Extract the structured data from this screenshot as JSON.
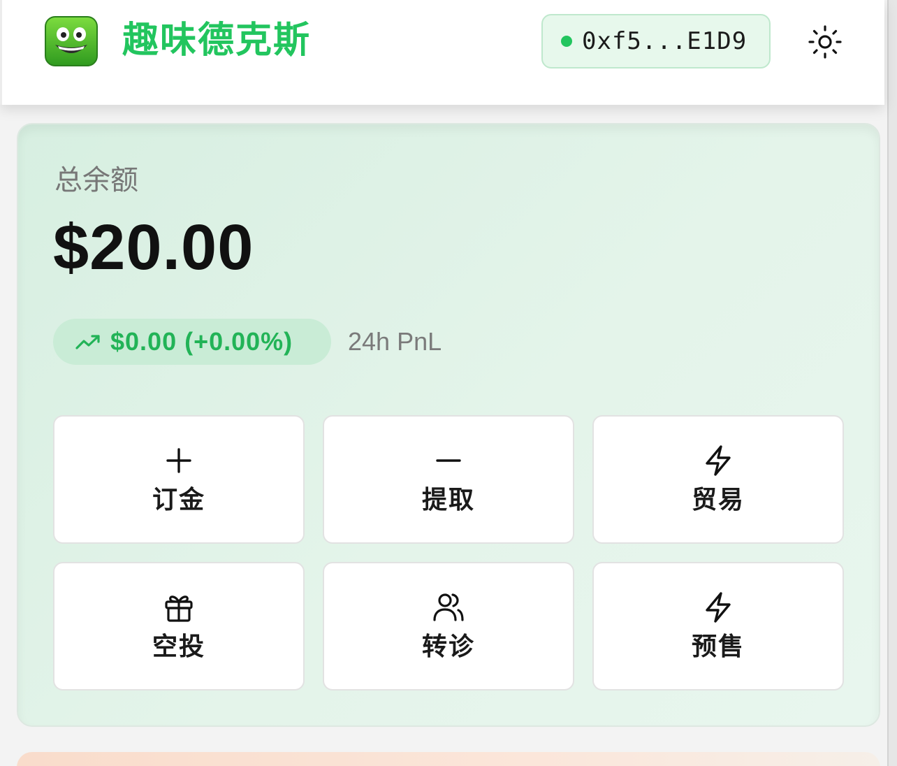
{
  "header": {
    "brand": "趣味德克斯",
    "logo_icon": "smiling-green-face-icon",
    "wallet": {
      "status": "connected",
      "address": "0xf5...E1D9"
    },
    "theme_icon": "sun-icon"
  },
  "balance_card": {
    "label": "总余额",
    "value": "$20.00",
    "pnl": {
      "value": "$0.00 (+0.00%)",
      "icon": "trending-up-icon",
      "label": "24h PnL"
    },
    "actions": [
      {
        "label": "订金",
        "icon": "plus-icon"
      },
      {
        "label": "提取",
        "icon": "minus-icon"
      },
      {
        "label": "贸易",
        "icon": "lightning-icon"
      },
      {
        "label": "空投",
        "icon": "gift-icon"
      },
      {
        "label": "转诊",
        "icon": "users-icon"
      },
      {
        "label": "预售",
        "icon": "lightning-icon"
      }
    ]
  },
  "colors": {
    "brand_green": "#22c55e",
    "pnl_green": "#22b357",
    "wallet_bg": "#e7f8ec",
    "card_bg": "#e4f4ea"
  }
}
